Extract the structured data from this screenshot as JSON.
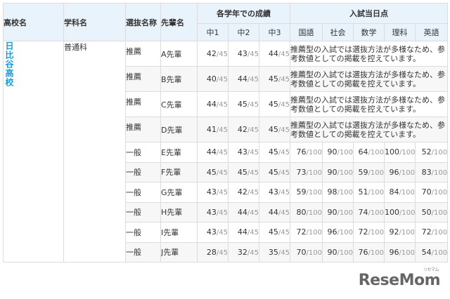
{
  "headers": {
    "school": "高校名",
    "department": "学科名",
    "selection": "選抜名称",
    "senior": "先輩名",
    "grades_group": "各学年での成績",
    "grades": [
      "中1",
      "中2",
      "中3"
    ],
    "exam_group": "入試当日点",
    "subjects": [
      "国語",
      "社会",
      "数学",
      "理科",
      "英語"
    ]
  },
  "school_name": "日比谷高校",
  "department_name": "普通科",
  "grade_max": "/45",
  "exam_max": "/100",
  "recommendation_note": "推薦型の入試では選抜方法が多様なため、参考数値としての掲載を控えています。",
  "rows": [
    {
      "selection": "推薦",
      "senior": "A先輩",
      "grades": [
        "42",
        "43",
        "44"
      ],
      "exam": null
    },
    {
      "selection": "推薦",
      "senior": "B先輩",
      "grades": [
        "40",
        "44",
        "45"
      ],
      "exam": null
    },
    {
      "selection": "推薦",
      "senior": "C先輩",
      "grades": [
        "44",
        "45",
        "45"
      ],
      "exam": null
    },
    {
      "selection": "推薦",
      "senior": "D先輩",
      "grades": [
        "41",
        "42",
        "45"
      ],
      "exam": null
    },
    {
      "selection": "一般",
      "senior": "E先輩",
      "grades": [
        "44",
        "43",
        "45"
      ],
      "exam": [
        "76",
        "90",
        "64",
        "100",
        "52"
      ]
    },
    {
      "selection": "一般",
      "senior": "F先輩",
      "grades": [
        "45",
        "45",
        "45"
      ],
      "exam": [
        "73",
        "90",
        "59",
        "96",
        "83"
      ]
    },
    {
      "selection": "一般",
      "senior": "G先輩",
      "grades": [
        "43",
        "42",
        "43"
      ],
      "exam": [
        "59",
        "98",
        "51",
        "84",
        "70"
      ]
    },
    {
      "selection": "一般",
      "senior": "H先輩",
      "grades": [
        "43",
        "44",
        "44"
      ],
      "exam": [
        "80",
        "90",
        "74",
        "100",
        "50"
      ]
    },
    {
      "selection": "一般",
      "senior": "I先輩",
      "grades": [
        "43",
        "44",
        "45"
      ],
      "exam": [
        "72",
        "96",
        "72",
        "92",
        "72"
      ]
    },
    {
      "selection": "一般",
      "senior": "J先輩",
      "grades": [
        "28",
        "32",
        "35"
      ],
      "exam": [
        "70",
        "90",
        "76",
        "96",
        "54"
      ]
    }
  ],
  "watermark": {
    "text": "ReseMom",
    "kana": "リセマム"
  }
}
